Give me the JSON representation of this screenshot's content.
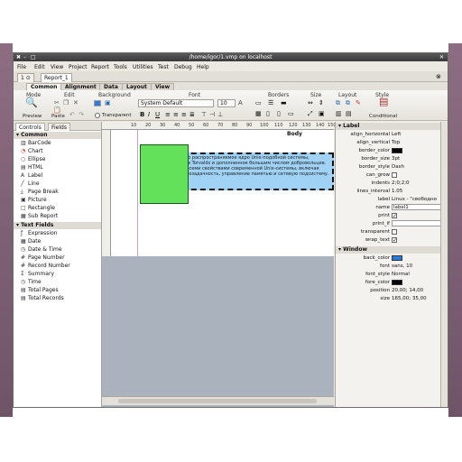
{
  "window": {
    "title": "/home/igor/1.vmp on localhost"
  },
  "titlebar_buttons": {
    "close": "✖",
    "min": "–",
    "max": "□",
    "right_close": "✕"
  },
  "menu": [
    "File",
    "Edit",
    "View",
    "Project",
    "Report",
    "Tools",
    "Utilities",
    "Test",
    "Debug",
    "Help"
  ],
  "doc_tabs": {
    "home": "1 ⊙",
    "report": "Report_1",
    "close": "⊗"
  },
  "ribbon": {
    "tabs": [
      "Common",
      "Alignment",
      "Data",
      "Layout",
      "View"
    ],
    "groups": [
      "Mode",
      "Edit",
      "Background",
      "Font",
      "Borders",
      "Size",
      "Layout",
      "Style"
    ],
    "preview_label": "Preview",
    "paste_label": "Paste",
    "transparent_label": "Transparent",
    "font_name": "System Default",
    "font_size": "10",
    "bold": "B",
    "italic": "I",
    "underline": "U",
    "conditional_label": "Conditional"
  },
  "left_panel": {
    "tabs": [
      "Controls",
      "Fields"
    ],
    "common_header": "Common",
    "common_items": [
      "BarCode",
      "Chart",
      "Ellipse",
      "HTML",
      "Label",
      "Line",
      "Page Break",
      "Picture",
      "Rectangle",
      "Sub Report"
    ],
    "fields_header": "Text Fields",
    "field_items": [
      "Expression",
      "Date",
      "Date & Time",
      "Page Number",
      "Record Number",
      "Summary",
      "Time",
      "Total Pages",
      "Total Records"
    ]
  },
  "design": {
    "band": "Body",
    "ruler_ticks": [
      "10",
      "20",
      "30",
      "40",
      "50",
      "60",
      "70",
      "80",
      "90",
      "100",
      "110",
      "120",
      "130",
      "140",
      "150"
    ],
    "label_text": "Linux — свободно распространяемое ядро Unix-подобной системы, написанное Linus Torvalds и дополненное большим числом добровольцев. Linux обладает всеми свойствами современной Unix-системы, включая настоящую многозадачность, управление памятью и сетевую подсистему."
  },
  "properties": {
    "label_header": "Label",
    "window_header": "Window",
    "align_horizontal": "Left",
    "align_vertical": "Top",
    "border_color": "#000000",
    "border_size": "3pt",
    "border_style": "Dash",
    "indents": "2;0;2;0",
    "lines_interval": "1.05",
    "label": "Linux - \"свободно",
    "name": "label1",
    "back_color": "#2a7ae2",
    "font": "sans, 10",
    "font_style": "Normal",
    "fore_color": "#000000",
    "position": "20,00; 14,00",
    "size": "165,00; 35,00",
    "keys": {
      "align_horizontal": "align_horizontal",
      "align_vertical": "align_vertical",
      "border_color": "border_color",
      "border_size": "border_size",
      "border_style": "border_style",
      "can_grow": "can_grow",
      "indents": "indents",
      "lines_interval": "lines_interval",
      "label": "label",
      "name": "name",
      "print": "print",
      "print_if": "print_if",
      "transparent": "transparent",
      "wrap_text": "wrap_text",
      "back_color": "back_color",
      "font": "font",
      "font_style": "font_style",
      "fore_color": "fore_color",
      "position": "position",
      "size": "size"
    },
    "checks": {
      "can_grow": false,
      "print": true,
      "transparent": false,
      "wrap_text": true
    }
  }
}
